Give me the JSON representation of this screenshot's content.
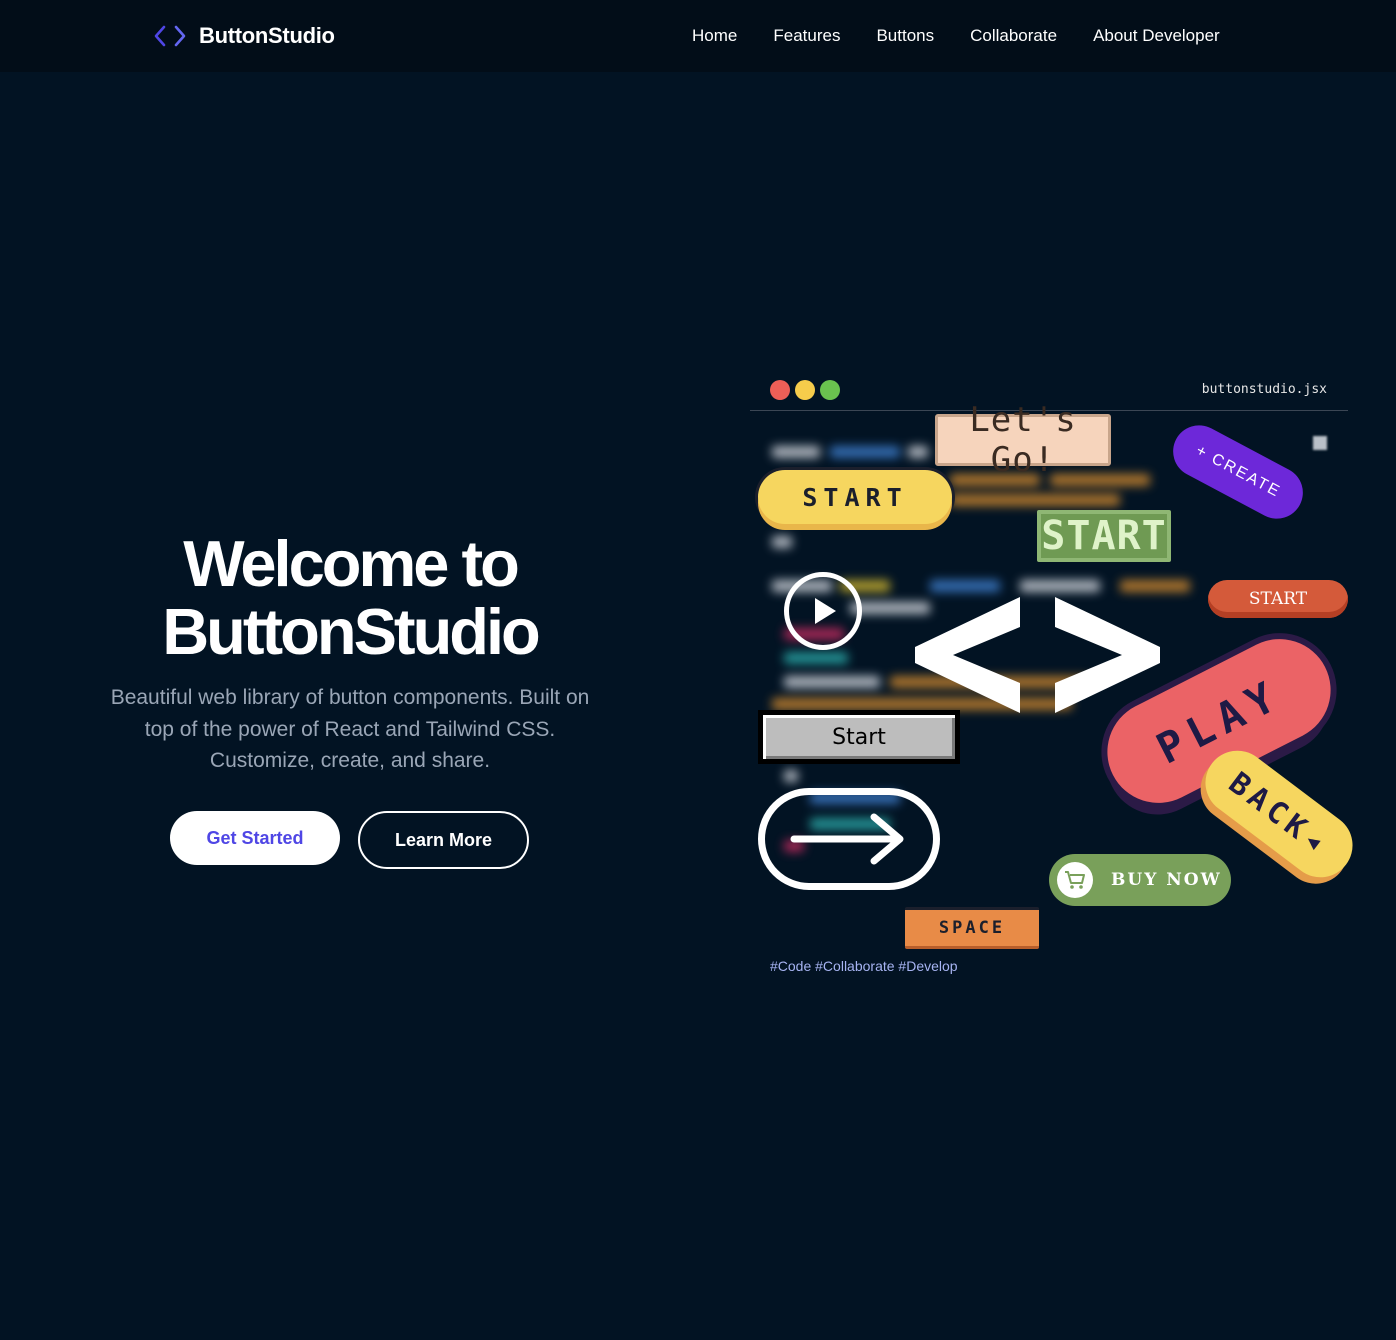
{
  "brand": {
    "name": "ButtonStudio",
    "icon": "code-brackets-icon",
    "accent": "#4f46e5"
  },
  "nav": {
    "items": [
      "Home",
      "Features",
      "Buttons",
      "Collaborate",
      "About Developer"
    ]
  },
  "hero": {
    "title_line1": "Welcome to",
    "title_line2": "ButtonStudio",
    "subtitle": "Beautiful web library of button components. Built on top of the power of React and Tailwind CSS. Customize, create, and share.",
    "primary_cta": "Get Started",
    "secondary_cta": "Learn More"
  },
  "showcase": {
    "file_name": "buttonstudio.jsx",
    "window_dots": [
      "#ed5f57",
      "#f6cc4b",
      "#6ac24f"
    ],
    "buttons": {
      "lets_go": "Let's Go!",
      "start_yellow": "START",
      "create": "+ CREATE",
      "start_pixel": "START",
      "start_red": "START",
      "start_grey": "Start",
      "play": "PLAY",
      "back": "BACK◂",
      "buy_now": "BUY NOW",
      "space": "SPACE"
    },
    "icons": [
      "play-icon",
      "arrow-right-icon",
      "cart-icon",
      "code-brackets-icon"
    ],
    "tags": "#Code #Collaborate #Develop"
  },
  "colors": {
    "background": "#021323",
    "navbar": "#020d18",
    "subtitle_text": "#9aa6b6"
  }
}
